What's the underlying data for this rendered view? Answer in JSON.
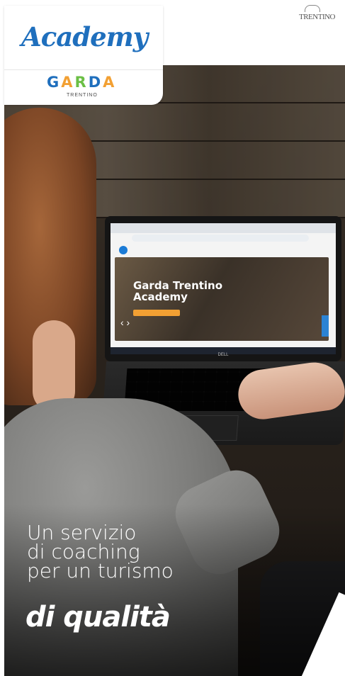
{
  "badge": {
    "title": "Academy",
    "logo_letters": [
      {
        "char": "G",
        "color": "#1f6fbd"
      },
      {
        "char": "A",
        "color": "#f2a033"
      },
      {
        "char": "R",
        "color": "#6bbf45"
      },
      {
        "char": "D",
        "color": "#1f6fbd"
      },
      {
        "char": "A",
        "color": "#f2a033"
      }
    ],
    "logo_subtitle": "TRENTINO"
  },
  "corner_logo": {
    "text": "TRENTINO"
  },
  "laptop": {
    "hero_title": "Garda Trentino",
    "hero_subtitle": "Academy",
    "brand": "DELL"
  },
  "headline": {
    "lines": [
      "Un servizio",
      "di coaching",
      "per un turismo"
    ],
    "highlight": "di qualità"
  },
  "colors": {
    "brand_blue": "#1f6fbd",
    "brand_orange": "#f2a033",
    "brand_green": "#6bbf45"
  }
}
